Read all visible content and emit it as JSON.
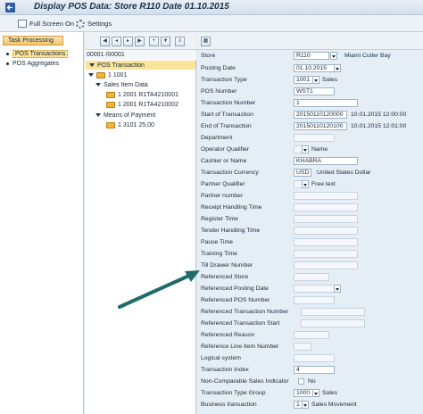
{
  "window": {
    "title": "Display POS Data: Store R110 Date 01.10.2015"
  },
  "toolbar": {
    "full_screen_label": "Full Screen On",
    "settings_label": "Settings"
  },
  "nav": {
    "task_processing_label": "Task Processing",
    "items": [
      {
        "label": "POS Transactions",
        "selected": true
      },
      {
        "label": "POS Aggregates",
        "selected": false
      }
    ]
  },
  "tree": {
    "header": "00001 /00001",
    "rows": [
      {
        "text": "POS Transaction",
        "level": 1,
        "selected": true
      },
      {
        "text": "1 1001",
        "level": 1,
        "selected": false
      },
      {
        "text": "Sales Item Data",
        "level": 2,
        "selected": false
      },
      {
        "text": "1 2001 R1TA4210001",
        "level": 3,
        "selected": false
      },
      {
        "text": "1 2001 R1TA4210002",
        "level": 3,
        "selected": false
      },
      {
        "text": "Means of Payment",
        "level": 2,
        "selected": false
      },
      {
        "text": "1 3101 25,00",
        "level": 3,
        "selected": false
      }
    ]
  },
  "fields": {
    "store": {
      "label": "Store",
      "value": "R110",
      "desc": "Miami Cutler Bay"
    },
    "posting_date": {
      "label": "Posting Date",
      "value": "01.10.2015"
    },
    "transaction_type": {
      "label": "Transaction Type",
      "value": "1001",
      "desc": "Sales"
    },
    "pos_number": {
      "label": "POS Number",
      "value": "WST1"
    },
    "transaction_number": {
      "label": "Transaction Number",
      "value": "1"
    },
    "start_of_transaction": {
      "label": "Start of Transaction",
      "value": "20150110120000",
      "desc": "10.01.2015 12:00:00"
    },
    "end_of_transaction": {
      "label": "End of Transaction",
      "value": "20150110120100",
      "desc": "10.01.2015 12:01:00"
    },
    "department": {
      "label": "Department",
      "value": ""
    },
    "operator_qualifier": {
      "label": "Operator Qualifier",
      "value": "",
      "desc": "Name"
    },
    "cashier_or_name": {
      "label": "Cashier or Name",
      "value": "KHABRA"
    },
    "transaction_currency": {
      "label": "Transaction Currency",
      "value": "USD",
      "desc": "United States Dollar"
    },
    "partner_qualifier": {
      "label": "Partner Qualifier",
      "value": "",
      "desc": "Free text"
    },
    "partner_number": {
      "label": "Partner number",
      "value": ""
    },
    "receipt_handling_time": {
      "label": "Receipt Handling Time",
      "value": ""
    },
    "register_time": {
      "label": "Register Time",
      "value": ""
    },
    "tender_handling_time": {
      "label": "Tender Handling Time",
      "value": ""
    },
    "pause_time": {
      "label": "Pause Time",
      "value": ""
    },
    "training_time": {
      "label": "Training Time",
      "value": ""
    },
    "till_drawer_number": {
      "label": "Till Drawer Number",
      "value": ""
    },
    "referenced_store": {
      "label": "Referenced Store",
      "value": ""
    },
    "referenced_posting_date": {
      "label": "Referenced Posting Date",
      "value": ""
    },
    "referenced_pos_number": {
      "label": "Referenced POS Number",
      "value": ""
    },
    "referenced_transaction_number": {
      "label": "Referenced Transaction Number",
      "value": ""
    },
    "referenced_transaction_start": {
      "label": "Referenced Transaction Start",
      "value": ""
    },
    "referenced_reason": {
      "label": "Referenced Reason",
      "value": ""
    },
    "reference_line_item_number": {
      "label": "Reference Line Item Number",
      "value": ""
    },
    "logical_system": {
      "label": "Logical system",
      "value": ""
    },
    "transaction_index": {
      "label": "Transaction Index",
      "value": "4"
    },
    "non_comparable_sales_indicator": {
      "label": "Non-Comparable Sales Indicator",
      "value": "",
      "desc": "No"
    },
    "transaction_type_group": {
      "label": "Transaction Type Group",
      "value": "1000",
      "desc": "Sales"
    },
    "business_transaction": {
      "label": "Business transaction",
      "value": "1",
      "desc": "Sales Movement"
    }
  },
  "colors": {
    "selection": "#fbe39a",
    "annotation_arrow": "#1f6b6b"
  }
}
